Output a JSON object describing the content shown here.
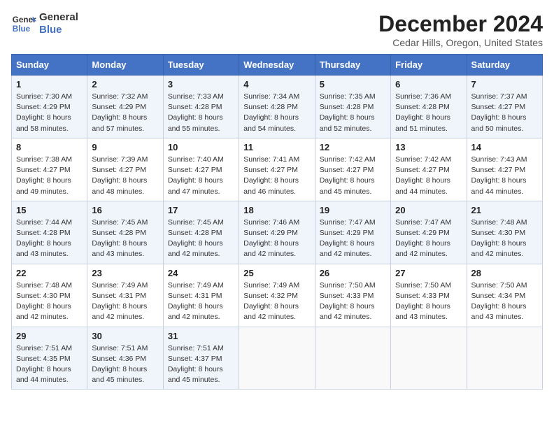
{
  "header": {
    "logo_line1": "General",
    "logo_line2": "Blue",
    "title": "December 2024",
    "subtitle": "Cedar Hills, Oregon, United States"
  },
  "days_of_week": [
    "Sunday",
    "Monday",
    "Tuesday",
    "Wednesday",
    "Thursday",
    "Friday",
    "Saturday"
  ],
  "weeks": [
    [
      {
        "day": "1",
        "sunrise": "Sunrise: 7:30 AM",
        "sunset": "Sunset: 4:29 PM",
        "daylight": "Daylight: 8 hours and 58 minutes."
      },
      {
        "day": "2",
        "sunrise": "Sunrise: 7:32 AM",
        "sunset": "Sunset: 4:29 PM",
        "daylight": "Daylight: 8 hours and 57 minutes."
      },
      {
        "day": "3",
        "sunrise": "Sunrise: 7:33 AM",
        "sunset": "Sunset: 4:28 PM",
        "daylight": "Daylight: 8 hours and 55 minutes."
      },
      {
        "day": "4",
        "sunrise": "Sunrise: 7:34 AM",
        "sunset": "Sunset: 4:28 PM",
        "daylight": "Daylight: 8 hours and 54 minutes."
      },
      {
        "day": "5",
        "sunrise": "Sunrise: 7:35 AM",
        "sunset": "Sunset: 4:28 PM",
        "daylight": "Daylight: 8 hours and 52 minutes."
      },
      {
        "day": "6",
        "sunrise": "Sunrise: 7:36 AM",
        "sunset": "Sunset: 4:28 PM",
        "daylight": "Daylight: 8 hours and 51 minutes."
      },
      {
        "day": "7",
        "sunrise": "Sunrise: 7:37 AM",
        "sunset": "Sunset: 4:27 PM",
        "daylight": "Daylight: 8 hours and 50 minutes."
      }
    ],
    [
      {
        "day": "8",
        "sunrise": "Sunrise: 7:38 AM",
        "sunset": "Sunset: 4:27 PM",
        "daylight": "Daylight: 8 hours and 49 minutes."
      },
      {
        "day": "9",
        "sunrise": "Sunrise: 7:39 AM",
        "sunset": "Sunset: 4:27 PM",
        "daylight": "Daylight: 8 hours and 48 minutes."
      },
      {
        "day": "10",
        "sunrise": "Sunrise: 7:40 AM",
        "sunset": "Sunset: 4:27 PM",
        "daylight": "Daylight: 8 hours and 47 minutes."
      },
      {
        "day": "11",
        "sunrise": "Sunrise: 7:41 AM",
        "sunset": "Sunset: 4:27 PM",
        "daylight": "Daylight: 8 hours and 46 minutes."
      },
      {
        "day": "12",
        "sunrise": "Sunrise: 7:42 AM",
        "sunset": "Sunset: 4:27 PM",
        "daylight": "Daylight: 8 hours and 45 minutes."
      },
      {
        "day": "13",
        "sunrise": "Sunrise: 7:42 AM",
        "sunset": "Sunset: 4:27 PM",
        "daylight": "Daylight: 8 hours and 44 minutes."
      },
      {
        "day": "14",
        "sunrise": "Sunrise: 7:43 AM",
        "sunset": "Sunset: 4:27 PM",
        "daylight": "Daylight: 8 hours and 44 minutes."
      }
    ],
    [
      {
        "day": "15",
        "sunrise": "Sunrise: 7:44 AM",
        "sunset": "Sunset: 4:28 PM",
        "daylight": "Daylight: 8 hours and 43 minutes."
      },
      {
        "day": "16",
        "sunrise": "Sunrise: 7:45 AM",
        "sunset": "Sunset: 4:28 PM",
        "daylight": "Daylight: 8 hours and 43 minutes."
      },
      {
        "day": "17",
        "sunrise": "Sunrise: 7:45 AM",
        "sunset": "Sunset: 4:28 PM",
        "daylight": "Daylight: 8 hours and 42 minutes."
      },
      {
        "day": "18",
        "sunrise": "Sunrise: 7:46 AM",
        "sunset": "Sunset: 4:29 PM",
        "daylight": "Daylight: 8 hours and 42 minutes."
      },
      {
        "day": "19",
        "sunrise": "Sunrise: 7:47 AM",
        "sunset": "Sunset: 4:29 PM",
        "daylight": "Daylight: 8 hours and 42 minutes."
      },
      {
        "day": "20",
        "sunrise": "Sunrise: 7:47 AM",
        "sunset": "Sunset: 4:29 PM",
        "daylight": "Daylight: 8 hours and 42 minutes."
      },
      {
        "day": "21",
        "sunrise": "Sunrise: 7:48 AM",
        "sunset": "Sunset: 4:30 PM",
        "daylight": "Daylight: 8 hours and 42 minutes."
      }
    ],
    [
      {
        "day": "22",
        "sunrise": "Sunrise: 7:48 AM",
        "sunset": "Sunset: 4:30 PM",
        "daylight": "Daylight: 8 hours and 42 minutes."
      },
      {
        "day": "23",
        "sunrise": "Sunrise: 7:49 AM",
        "sunset": "Sunset: 4:31 PM",
        "daylight": "Daylight: 8 hours and 42 minutes."
      },
      {
        "day": "24",
        "sunrise": "Sunrise: 7:49 AM",
        "sunset": "Sunset: 4:31 PM",
        "daylight": "Daylight: 8 hours and 42 minutes."
      },
      {
        "day": "25",
        "sunrise": "Sunrise: 7:49 AM",
        "sunset": "Sunset: 4:32 PM",
        "daylight": "Daylight: 8 hours and 42 minutes."
      },
      {
        "day": "26",
        "sunrise": "Sunrise: 7:50 AM",
        "sunset": "Sunset: 4:33 PM",
        "daylight": "Daylight: 8 hours and 42 minutes."
      },
      {
        "day": "27",
        "sunrise": "Sunrise: 7:50 AM",
        "sunset": "Sunset: 4:33 PM",
        "daylight": "Daylight: 8 hours and 43 minutes."
      },
      {
        "day": "28",
        "sunrise": "Sunrise: 7:50 AM",
        "sunset": "Sunset: 4:34 PM",
        "daylight": "Daylight: 8 hours and 43 minutes."
      }
    ],
    [
      {
        "day": "29",
        "sunrise": "Sunrise: 7:51 AM",
        "sunset": "Sunset: 4:35 PM",
        "daylight": "Daylight: 8 hours and 44 minutes."
      },
      {
        "day": "30",
        "sunrise": "Sunrise: 7:51 AM",
        "sunset": "Sunset: 4:36 PM",
        "daylight": "Daylight: 8 hours and 45 minutes."
      },
      {
        "day": "31",
        "sunrise": "Sunrise: 7:51 AM",
        "sunset": "Sunset: 4:37 PM",
        "daylight": "Daylight: 8 hours and 45 minutes."
      },
      null,
      null,
      null,
      null
    ]
  ]
}
